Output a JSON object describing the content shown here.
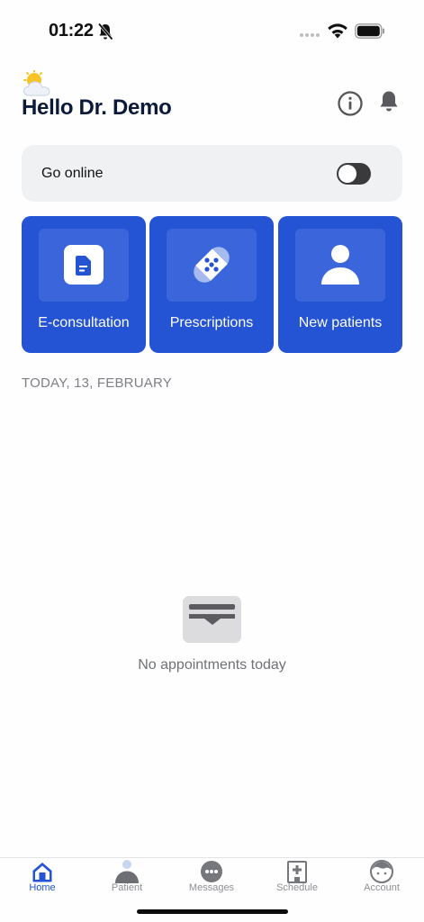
{
  "status_bar": {
    "time": "01:22",
    "icons": [
      "bell-slash-icon",
      "signal-dots-icon",
      "wifi-icon",
      "battery-icon"
    ]
  },
  "header": {
    "weather_icon": "sun-behind-cloud-icon",
    "greeting": "Hello Dr. Demo",
    "info_icon": "info-circle-icon",
    "notification_icon": "bell-icon"
  },
  "online": {
    "label": "Go online",
    "toggle_state": "off"
  },
  "tiles": [
    {
      "label": "E-consultation",
      "icon": "document-icon"
    },
    {
      "label": "Prescriptions",
      "icon": "pill-icon"
    },
    {
      "label": "New patients",
      "icon": "person-icon"
    }
  ],
  "date_heading": "TODAY, 13, FEBRUARY",
  "empty_state": {
    "icon": "inbox-tray-icon",
    "text": "No appointments today"
  },
  "nav": {
    "items": [
      {
        "label": "Home",
        "icon": "home-icon",
        "active": true
      },
      {
        "label": "Patient",
        "icon": "patient-icon",
        "active": false
      },
      {
        "label": "Messages",
        "icon": "chat-bubble-icon",
        "active": false
      },
      {
        "label": "Schedule",
        "icon": "hospital-icon",
        "active": false
      },
      {
        "label": "Account",
        "icon": "face-icon",
        "active": false
      }
    ]
  },
  "colors": {
    "accent": "#2453d3",
    "tile_inner": "#3b66db",
    "card_bg": "#f0f1f3",
    "muted_text": "#7d7f85",
    "toggle_off": "#3a3a3c"
  }
}
